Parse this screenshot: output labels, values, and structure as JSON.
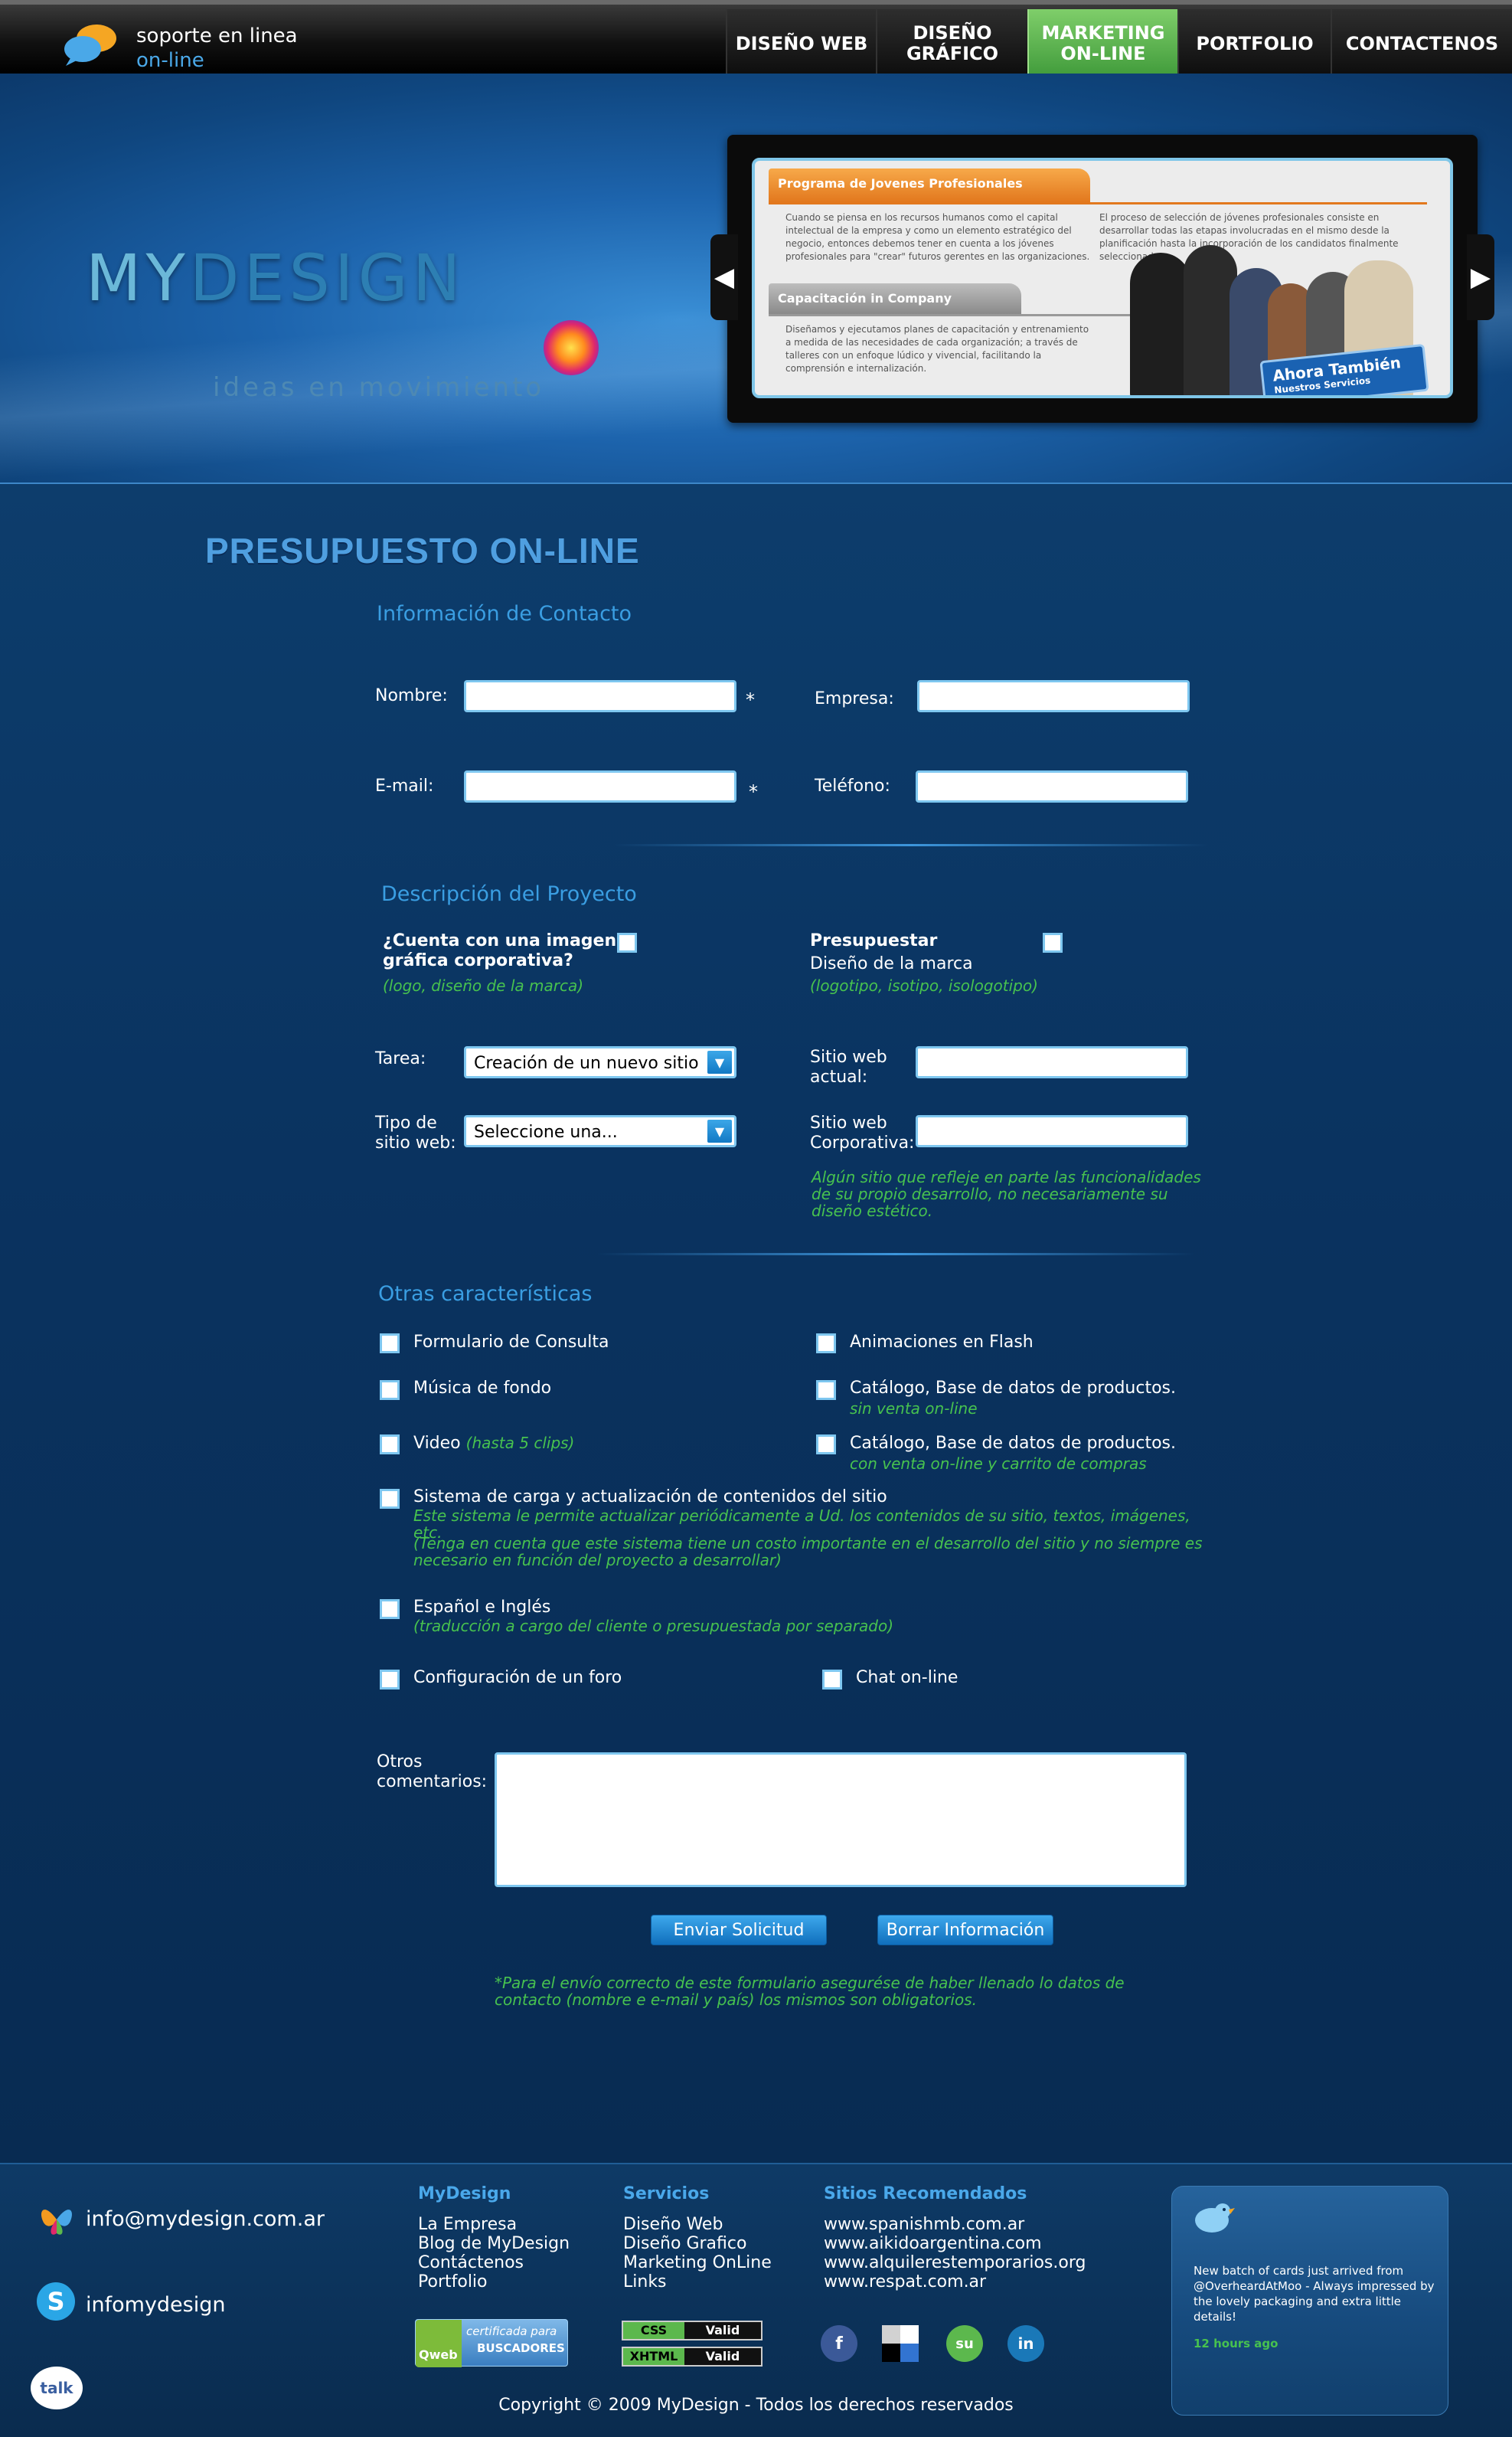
{
  "header": {
    "support_line1": "soporte en linea",
    "support_line2": "on-line",
    "nav": [
      {
        "label": "DISEÑO WEB"
      },
      {
        "label": "DISEÑO\nGRÁFICO"
      },
      {
        "label": "MARKETING\nON-LINE",
        "active": true
      },
      {
        "label": "PORTFOLIO"
      },
      {
        "label": "CONTACTENOS"
      }
    ],
    "accent_active": "#5cb84d"
  },
  "hero": {
    "logo_part1": "MY",
    "logo_part2": "DESIGN",
    "tagline": "ideas en movimiento",
    "slide": {
      "tab1": "Programa de Jovenes Profesionales",
      "text1": "Cuando se piensa en los recursos humanos como el capital intelectual de la empresa y como un elemento estratégico del negocio, entonces debemos tener en cuenta a los jóvenes profesionales para \"crear\" futuros gerentes en las organizaciones.",
      "text2": "El proceso de selección de jóvenes profesionales consiste en desarrollar todas las etapas involucradas en el mismo desde la planificación hasta la incorporación de los candidatos finalmente seleccionados.",
      "tab2": "Capacitación in Company",
      "text3": "Diseñamos y ejecutamos planes de capacitación y entrenamiento a medida de las necesidades de cada organización; a través de talleres con un enfoque lúdico y vivencial, facilitando la comprensión e internalización.",
      "badge_title": "Ahora También",
      "badge_sub": "Nuestros Servicios"
    }
  },
  "form": {
    "title": "PRESUPUESTO ON-LINE",
    "contact_section": "Información de Contacto",
    "nombre_label": "Nombre:",
    "empresa_label": "Empresa:",
    "email_label": "E-mail:",
    "telefono_label": "Teléfono:",
    "required_mark": "*",
    "project_section": "Descripción del Proyecto",
    "imagen_q": "¿Cuenta con una imagen gráfica corporativa?",
    "imagen_note": "(logo, diseño de la marca)",
    "presupuestar_title": "Presupuestar",
    "presupuestar_sub": "Diseño de la marca",
    "presupuestar_note": "(logotipo, isotipo, isologotipo)",
    "tarea_label": "Tarea:",
    "tarea_value": "Creación de un nuevo sitio",
    "tipo_label": "Tipo de sitio web:",
    "tipo_value": "Seleccione una...",
    "sitio_actual_label": "Sitio web actual:",
    "sitio_corp_label": "Sitio web Corporativa:",
    "sitio_note": "Algún sitio que refleje en parte las funcionalidades de su propio desarrollo, no necesariamente su diseño estético.",
    "other_section": "Otras características",
    "features": {
      "formulario": "Formulario de Consulta",
      "flash": "Animaciones en Flash",
      "musica": "Música de fondo",
      "catalogo1": "Catálogo, Base de datos de productos.",
      "catalogo1_note": "sin venta on-line",
      "video": "Video",
      "video_note": "(hasta 5 clips)",
      "catalogo2": "Catálogo, Base de datos de productos.",
      "catalogo2_note": "con venta on-line y carrito de compras",
      "sistema": "Sistema de carga y actualización de contenidos del sitio",
      "sistema_note1": "Este sistema le permite actualizar periódicamente a Ud. los contenidos de su sitio, textos, imágenes, etc.",
      "sistema_note2": "(Tenga en cuenta que este sistema tiene un costo importante en el desarrollo del sitio y no siempre es necesario en función del proyecto a desarrollar)",
      "idioma": "Español e Inglés",
      "idioma_note": "(traducción a cargo del cliente o presupuestada por separado)",
      "foro": "Configuración de un foro",
      "chat": "Chat on-line"
    },
    "comentarios_label": "Otros comentarios:",
    "submit_label": "Enviar Solicitud",
    "reset_label": "Borrar Información",
    "footnote": "*Para el envío correcto de este formulario asegurése de haber llenado lo datos de contacto (nombre e e-mail y país) los mismos son obligatorios."
  },
  "footer": {
    "email": "info@mydesign.com.ar",
    "skype": "infomydesign",
    "talk_icon_text": "talk",
    "col1_title": "MyDesign",
    "col1_items": [
      "La Empresa",
      "Blog de MyDesign",
      "Contáctenos",
      "Portfolio"
    ],
    "col2_title": "Servicios",
    "col2_items": [
      "Diseño Web",
      "Diseño Grafico",
      "Marketing OnLine",
      "Links"
    ],
    "col3_title": "Sitios Recomendados",
    "col3_items": [
      "www.spanishmb.com.ar",
      "www.aikidoargentina.com",
      "www.alquilerestemporarios.org",
      "www.respat.com.ar"
    ],
    "badge_qweb_title": "certificada para",
    "badge_qweb_sub": "BUSCADORES",
    "badge_qweb_brand": "Qweb",
    "css_label": "CSS",
    "xhtml_label": "XHTML",
    "valid_label": "Valid",
    "social": [
      "facebook-icon",
      "delicious-icon",
      "stumbleupon-icon",
      "linkedin-icon"
    ],
    "tweet_text": "New batch of cards just arrived from @OverheardAtMoo - Always impressed by the lovely packaging and extra little details!",
    "tweet_time": "12 hours ago",
    "copyright": "Copyright © 2009 MyDesign - Todos los derechos reservados"
  }
}
